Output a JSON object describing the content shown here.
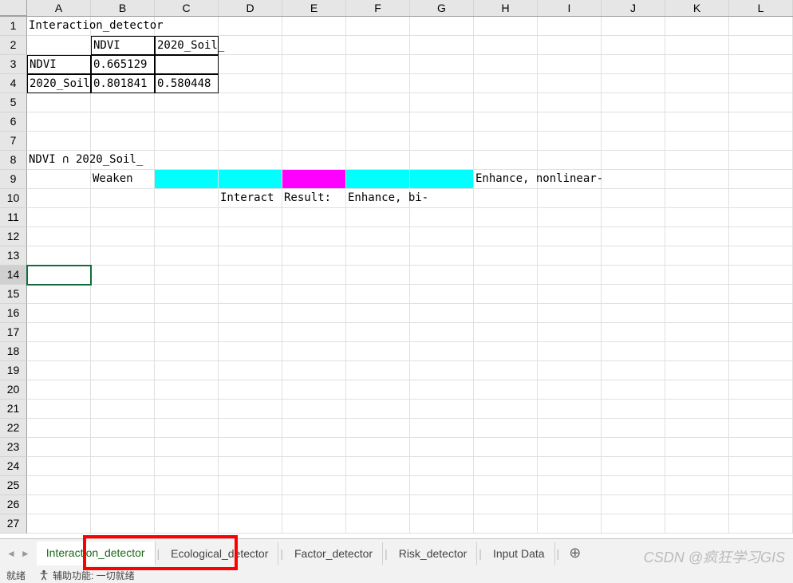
{
  "columns": [
    "A",
    "B",
    "C",
    "D",
    "E",
    "F",
    "G",
    "H",
    "I",
    "J",
    "K",
    "L"
  ],
  "row_count": 27,
  "selected_row": 14,
  "cells": {
    "r1": {
      "A": "Interaction_detector"
    },
    "r2": {
      "B": "NDVI",
      "C": "2020_Soil_"
    },
    "r3": {
      "A": "NDVI",
      "B": "0.665129"
    },
    "r4": {
      "A": "2020_Soil",
      "B": "0.801841",
      "C": "0.580448"
    },
    "r8": {
      "A": "NDVI ∩ 2020_Soil_"
    },
    "r9": {
      "B": "Weaken",
      "H": "Enhance, nonlinear-"
    },
    "r10": {
      "D": "Interact",
      "E": "Result:",
      "F": "Enhance, bi-"
    }
  },
  "bordered_cells": [
    "r2B",
    "r2C",
    "r3A",
    "r3B",
    "r3C",
    "r4A",
    "r4B",
    "r4C"
  ],
  "colored_cells": {
    "cyan": [
      "r9C",
      "r9D",
      "r9F",
      "r9G"
    ],
    "magenta": [
      "r9E"
    ]
  },
  "sheet_tabs": {
    "active": "Interaction_detector",
    "tabs": [
      "Interaction_detector",
      "Ecological_detector",
      "Factor_detector",
      "Risk_detector",
      "Input Data"
    ]
  },
  "status": {
    "ready": "就绪",
    "accessibility": "辅助功能: 一切就绪"
  },
  "watermark": "CSDN @疯狂学习GIS"
}
